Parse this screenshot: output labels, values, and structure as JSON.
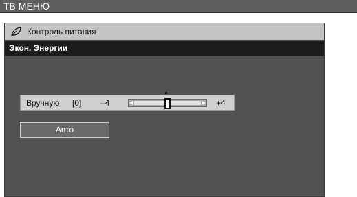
{
  "menu": {
    "title": "ТВ МЕНЮ"
  },
  "panel": {
    "header": {
      "icon": "leaf-icon",
      "title": "Контроль питания"
    },
    "subheader": "Экон. Энергии"
  },
  "slider": {
    "label": "Вручную",
    "value_text": "[0]",
    "min_label": "–4",
    "max_label": "+4",
    "min": -4,
    "max": 4,
    "value": 0
  },
  "auto_button": {
    "label": "Авто"
  },
  "colors": {
    "menu_bar": "#5e5e5e",
    "panel_bg": "#525252",
    "header_bg": "#c4c4c4",
    "subheader_bg": "#1c1c1c",
    "slider_bg": "#cfcfcf"
  }
}
